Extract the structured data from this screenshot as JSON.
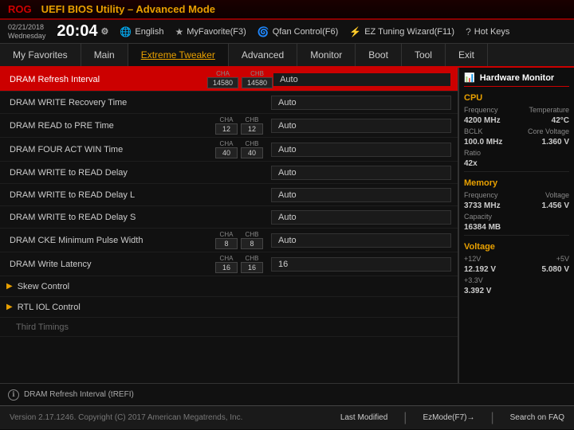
{
  "header": {
    "logo": "ROG",
    "title": "UEFI BIOS Utility – ",
    "mode": "Advanced Mode"
  },
  "time_bar": {
    "date": "02/21/2018",
    "day": "Wednesday",
    "time": "20:04",
    "items": [
      {
        "icon": "🌐",
        "label": "English"
      },
      {
        "icon": "★",
        "label": "MyFavorite(F3)"
      },
      {
        "icon": "🌀",
        "label": "Qfan Control(F6)"
      },
      {
        "icon": "⚡",
        "label": "EZ Tuning Wizard(F11)"
      },
      {
        "icon": "?",
        "label": "Hot Keys"
      }
    ]
  },
  "nav": {
    "tabs": [
      {
        "label": "My Favorites",
        "active": false
      },
      {
        "label": "Main",
        "active": false
      },
      {
        "label": "Extreme Tweaker",
        "active": true
      },
      {
        "label": "Advanced",
        "active": false
      },
      {
        "label": "Monitor",
        "active": false
      },
      {
        "label": "Boot",
        "active": false
      },
      {
        "label": "Tool",
        "active": false
      },
      {
        "label": "Exit",
        "active": false
      }
    ]
  },
  "settings": [
    {
      "type": "row",
      "highlighted": true,
      "name": "DRAM Refresh Interval",
      "chips": [
        {
          "label": "CHA",
          "value": "14580"
        },
        {
          "label": "CHB",
          "value": "14580"
        }
      ],
      "value": "Auto",
      "red_border": true
    },
    {
      "type": "row",
      "highlighted": false,
      "name": "DRAM WRITE Recovery Time",
      "chips": [],
      "value": "Auto",
      "red_border": false
    },
    {
      "type": "row",
      "highlighted": false,
      "name": "DRAM READ to PRE Time",
      "chips": [
        {
          "label": "CHA",
          "value": "12"
        },
        {
          "label": "CHB",
          "value": "12"
        }
      ],
      "value": "Auto",
      "red_border": false
    },
    {
      "type": "row",
      "highlighted": false,
      "name": "DRAM FOUR ACT WIN Time",
      "chips": [
        {
          "label": "CHA",
          "value": "40"
        },
        {
          "label": "CHB",
          "value": "40"
        }
      ],
      "value": "Auto",
      "red_border": false
    },
    {
      "type": "row",
      "highlighted": false,
      "name": "DRAM WRITE to READ Delay",
      "chips": [],
      "value": "Auto",
      "red_border": false
    },
    {
      "type": "row",
      "highlighted": false,
      "name": "DRAM WRITE to READ Delay L",
      "chips": [],
      "value": "Auto",
      "red_border": false
    },
    {
      "type": "row",
      "highlighted": false,
      "name": "DRAM WRITE to READ Delay S",
      "chips": [],
      "value": "Auto",
      "red_border": false
    },
    {
      "type": "row",
      "highlighted": false,
      "name": "DRAM CKE Minimum Pulse Width",
      "chips": [
        {
          "label": "CHA",
          "value": "8"
        },
        {
          "label": "CHB",
          "value": "8"
        }
      ],
      "value": "Auto",
      "red_border": false
    },
    {
      "type": "row",
      "highlighted": false,
      "name": "DRAM Write Latency",
      "chips": [
        {
          "label": "CHA",
          "value": "16"
        },
        {
          "label": "CHB",
          "value": "16"
        }
      ],
      "value": "16",
      "red_border": false
    },
    {
      "type": "section",
      "name": "Skew Control"
    },
    {
      "type": "section",
      "name": "RTL IOL Control"
    },
    {
      "type": "sub",
      "name": "Third Timings"
    }
  ],
  "hw_monitor": {
    "title": "Hardware Monitor",
    "cpu": {
      "label": "CPU",
      "frequency_label": "Frequency",
      "frequency_value": "4200 MHz",
      "temperature_label": "Temperature",
      "temperature_value": "42°C",
      "bclk_label": "BCLK",
      "bclk_value": "100.0 MHz",
      "core_voltage_label": "Core Voltage",
      "core_voltage_value": "1.360 V",
      "ratio_label": "Ratio",
      "ratio_value": "42x"
    },
    "memory": {
      "label": "Memory",
      "frequency_label": "Frequency",
      "frequency_value": "3733 MHz",
      "voltage_label": "Voltage",
      "voltage_value": "1.456 V",
      "capacity_label": "Capacity",
      "capacity_value": "16384 MB"
    },
    "voltage": {
      "label": "Voltage",
      "v12_label": "+12V",
      "v12_value": "12.192 V",
      "v5_label": "+5V",
      "v5_value": "5.080 V",
      "v33_label": "+3.3V",
      "v33_value": "3.392 V"
    }
  },
  "bottom_info": {
    "icon": "ℹ",
    "text": "DRAM Refresh Interval (tREFI)"
  },
  "footer": {
    "copyright": "Version 2.17.1246. Copyright (C) 2017 American Megatrends, Inc.",
    "last_modified": "Last Modified",
    "ez_mode": "EzMode(F7)→",
    "search_faq": "Search on FAQ"
  }
}
